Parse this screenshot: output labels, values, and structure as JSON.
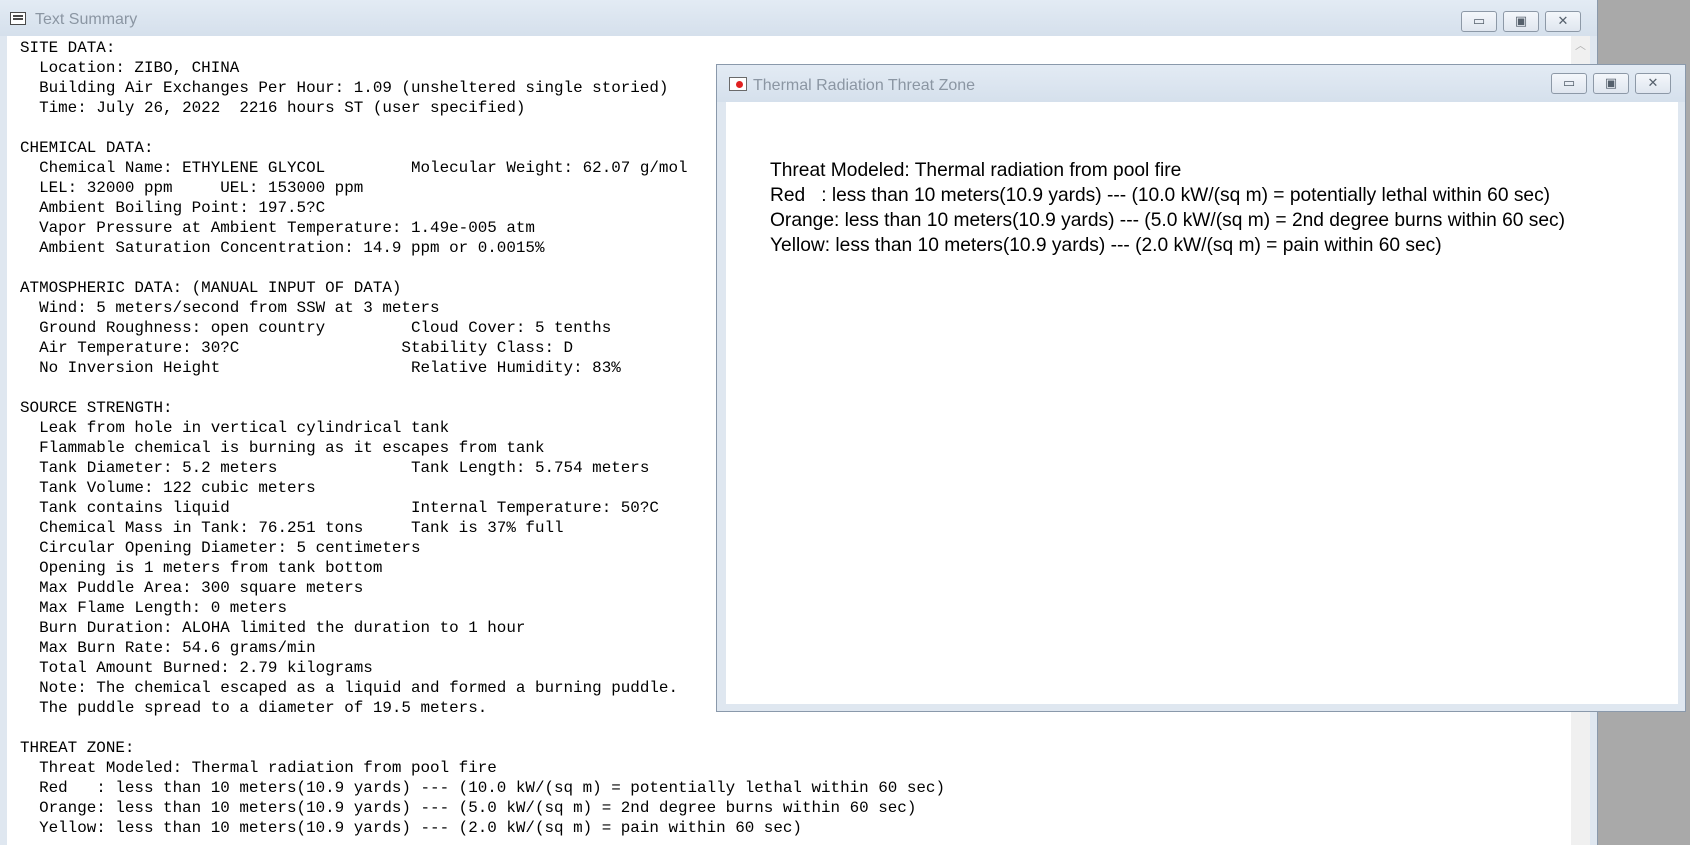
{
  "main_window": {
    "title": "Text Summary",
    "controls": {
      "minimize": "▭",
      "maximize": "▣",
      "close": "✕"
    },
    "scroll_up": "︿",
    "lines": [
      "SITE DATA:",
      "  Location: ZIBO, CHINA",
      "  Building Air Exchanges Per Hour: 1.09 (unsheltered single storied)",
      "  Time: July 26, 2022  2216 hours ST (user specified)",
      "",
      "CHEMICAL DATA:",
      "  Chemical Name: ETHYLENE GLYCOL         Molecular Weight: 62.07 g/mol",
      "  LEL: 32000 ppm     UEL: 153000 ppm",
      "  Ambient Boiling Point: 197.5?C",
      "  Vapor Pressure at Ambient Temperature: 1.49e-005 atm",
      "  Ambient Saturation Concentration: 14.9 ppm or 0.0015%",
      "",
      "ATMOSPHERIC DATA: (MANUAL INPUT OF DATA)",
      "  Wind: 5 meters/second from SSW at 3 meters",
      "  Ground Roughness: open country         Cloud Cover: 5 tenths",
      "  Air Temperature: 30?C                 Stability Class: D",
      "  No Inversion Height                    Relative Humidity: 83%",
      "",
      "SOURCE STRENGTH:",
      "  Leak from hole in vertical cylindrical tank",
      "  Flammable chemical is burning as it escapes from tank",
      "  Tank Diameter: 5.2 meters              Tank Length: 5.754 meters",
      "  Tank Volume: 122 cubic meters",
      "  Tank contains liquid                   Internal Temperature: 50?C",
      "  Chemical Mass in Tank: 76.251 tons     Tank is 37% full",
      "  Circular Opening Diameter: 5 centimeters",
      "  Opening is 1 meters from tank bottom",
      "  Max Puddle Area: 300 square meters",
      "  Max Flame Length: 0 meters",
      "  Burn Duration: ALOHA limited the duration to 1 hour",
      "  Max Burn Rate: 54.6 grams/min",
      "  Total Amount Burned: 2.79 kilograms",
      "  Note: The chemical escaped as a liquid and formed a burning puddle.",
      "  The puddle spread to a diameter of 19.5 meters.",
      "",
      "THREAT ZONE:",
      "  Threat Modeled: Thermal radiation from pool fire",
      "  Red   : less than 10 meters(10.9 yards) --- (10.0 kW/(sq m) = potentially lethal within 60 sec)",
      "  Orange: less than 10 meters(10.9 yards) --- (5.0 kW/(sq m) = 2nd degree burns within 60 sec)",
      "  Yellow: less than 10 meters(10.9 yards) --- (2.0 kW/(sq m) = pain within 60 sec)"
    ]
  },
  "thermal_window": {
    "title": "Thermal Radiation Threat Zone",
    "controls": {
      "minimize": "▭",
      "maximize": "▣",
      "close": "✕"
    },
    "lines": [
      "Threat Modeled: Thermal radiation from pool fire",
      "Red   : less than 10 meters(10.9 yards) --- (10.0 kW/(sq m) = potentially lethal within 60 sec)",
      "Orange: less than 10 meters(10.9 yards) --- (5.0 kW/(sq m) = 2nd degree burns within 60 sec)",
      "Yellow: less than 10 meters(10.9 yards) --- (2.0 kW/(sq m) = pain within 60 sec)"
    ]
  }
}
